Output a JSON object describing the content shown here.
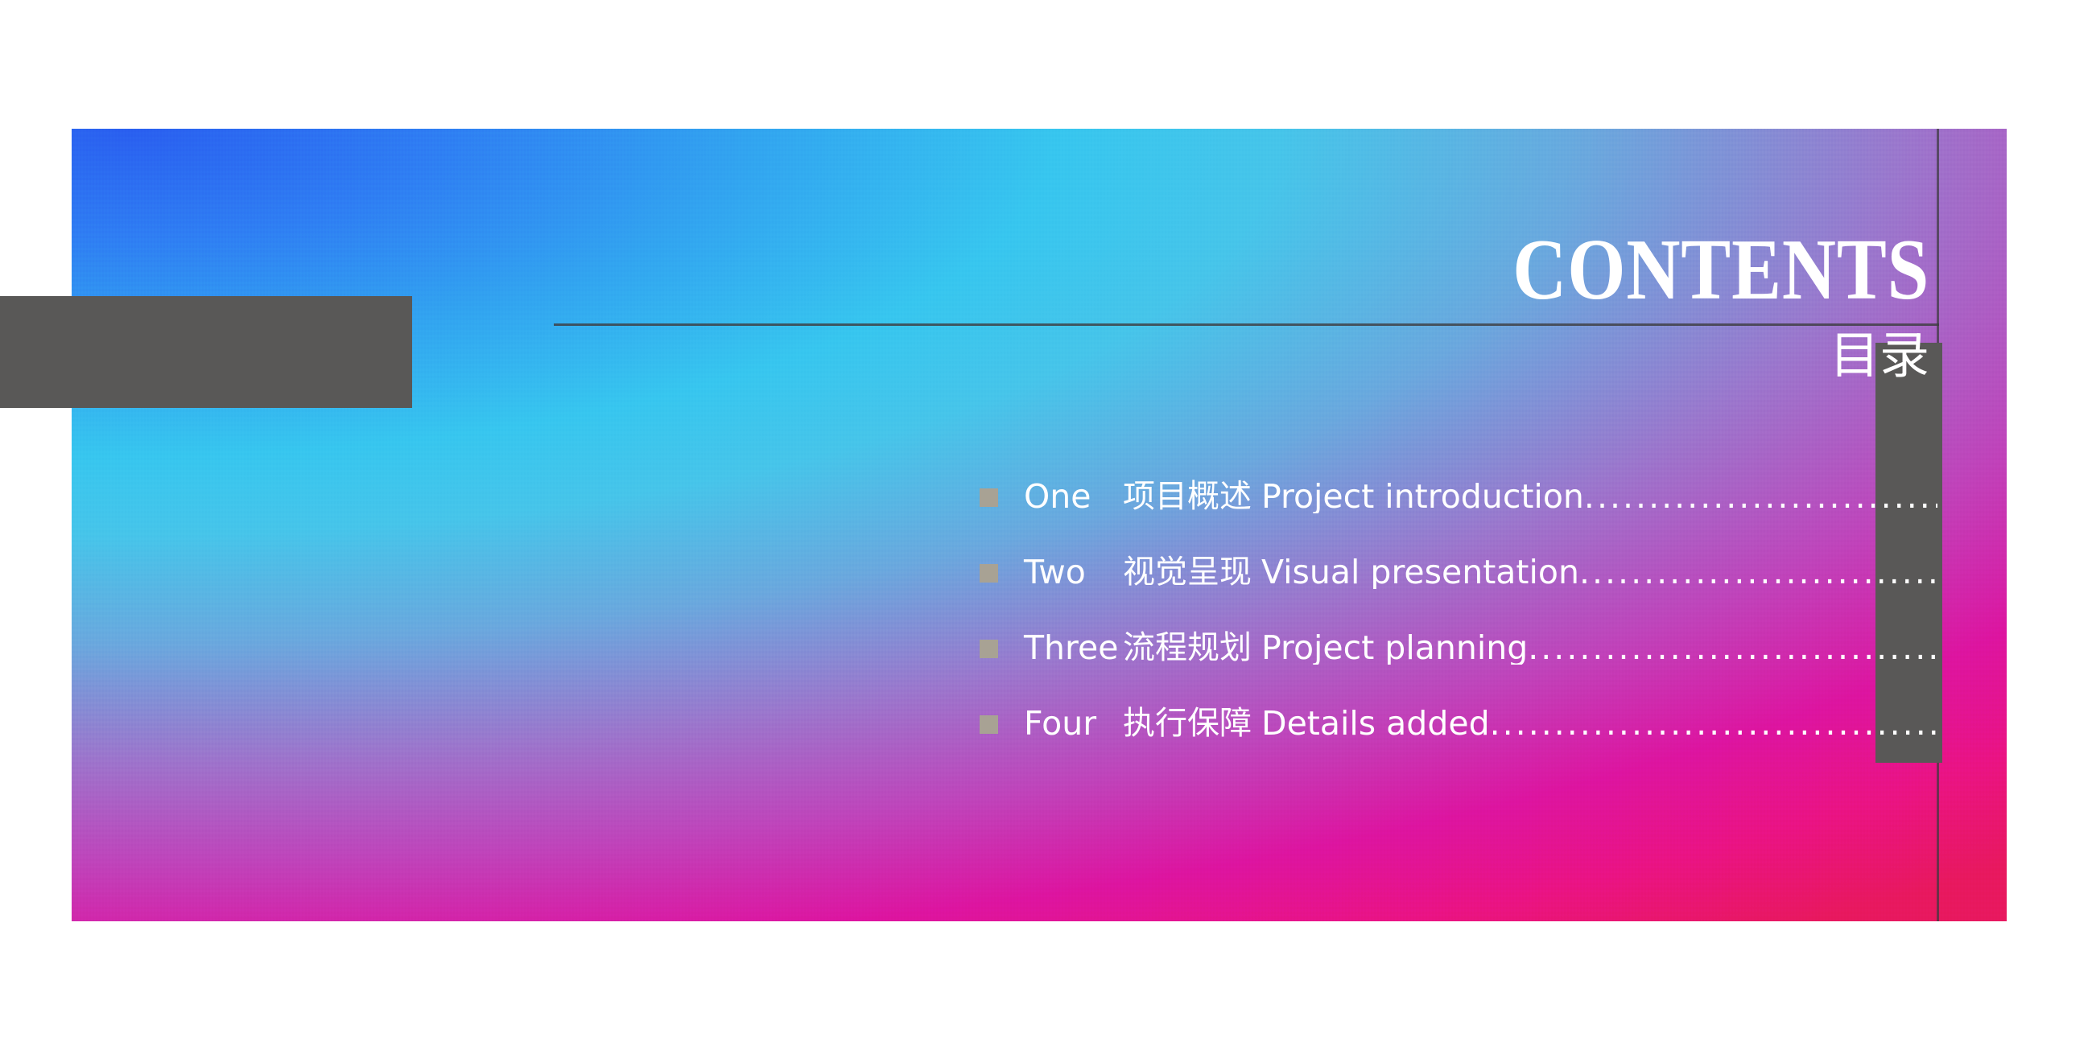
{
  "slide": {
    "heading_en": "CONTENTS",
    "heading_cn": "目录",
    "leader_dots": "..........................................................................",
    "colors": {
      "gradient_top_left": "#2a5ff0",
      "gradient_bottom_left": "#37c6ef",
      "gradient_top_right": "#c836ab",
      "gradient_bottom_right": "#e8185f",
      "grey_block": "#595857",
      "rule": "#3e3e42",
      "bullet": "#a8a294",
      "text": "#ffffff"
    },
    "decor": {
      "left_block_name": "grey-block-left",
      "right_block_name": "grey-block-right",
      "vertical_rule_name": "vertical-rule",
      "horizontal_rule_name": "horizontal-rule"
    },
    "contents": [
      {
        "index": "One",
        "title_cn": "项目概述",
        "title_en": "Project introduction"
      },
      {
        "index": "Two",
        "title_cn": "视觉呈现",
        "title_en": "Visual presentation"
      },
      {
        "index": "Three",
        "title_cn": "流程规划",
        "title_en": "Project planning"
      },
      {
        "index": "Four",
        "title_cn": "执行保障",
        "title_en": "Details added"
      }
    ]
  }
}
